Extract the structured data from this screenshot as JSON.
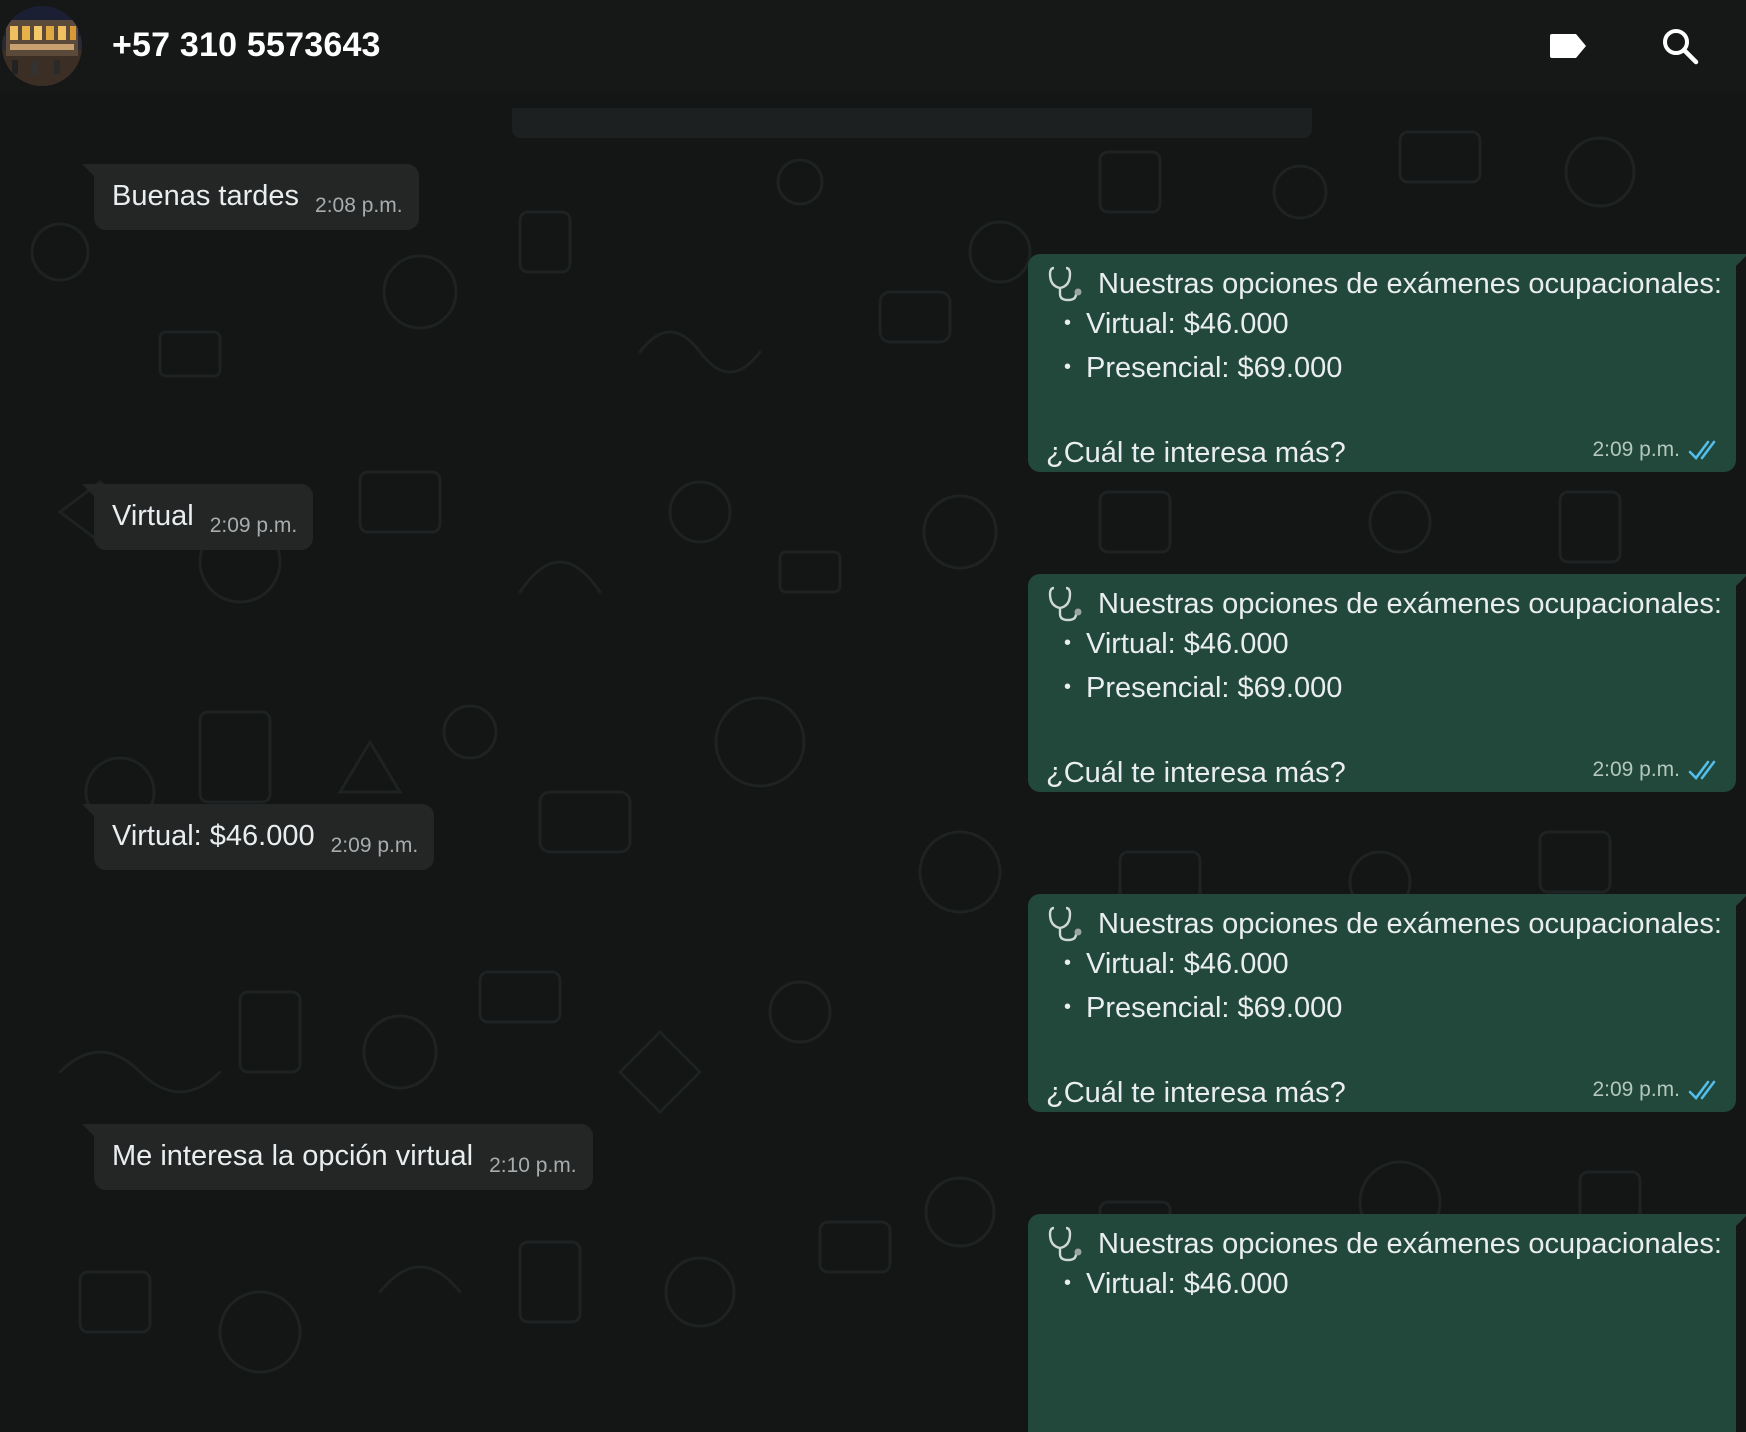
{
  "header": {
    "contact_name": "+57 310 5573643",
    "labels_icon": "label-tag-icon",
    "search_icon": "search-icon"
  },
  "colors": {
    "header_bg": "#161717",
    "chat_bg": "#141515",
    "incoming_bubble": "#242626",
    "outgoing_bubble": "#21483a",
    "read_ticks": "#53bdeb"
  },
  "messages": [
    {
      "direction": "in",
      "text": "Buenas tardes",
      "time": "2:08 p.m."
    },
    {
      "direction": "out",
      "title": "Nuestras opciones de exámenes ocupacionales:",
      "items": [
        "Virtual: $46.000",
        "Presencial: $69.000"
      ],
      "question": "¿Cuál te interesa más?",
      "time": "2:09 p.m.",
      "status": "read"
    },
    {
      "direction": "in",
      "text": "Virtual",
      "time": "2:09 p.m."
    },
    {
      "direction": "out",
      "title": "Nuestras opciones de exámenes ocupacionales:",
      "items": [
        "Virtual: $46.000",
        "Presencial: $69.000"
      ],
      "question": "¿Cuál te interesa más?",
      "time": "2:09 p.m.",
      "status": "read"
    },
    {
      "direction": "in",
      "text": "Virtual: $46.000",
      "time": "2:09 p.m."
    },
    {
      "direction": "out",
      "title": "Nuestras opciones de exámenes ocupacionales:",
      "items": [
        "Virtual: $46.000",
        "Presencial: $69.000"
      ],
      "question": "¿Cuál te interesa más?",
      "time": "2:09 p.m.",
      "status": "read"
    },
    {
      "direction": "in",
      "text": "Me interesa la opción virtual",
      "time": "2:10 p.m."
    },
    {
      "direction": "out",
      "title": "Nuestras opciones de exámenes ocupacionales:",
      "items": [
        "Virtual: $46.000"
      ],
      "question": "",
      "time": "",
      "status": "partial"
    }
  ]
}
